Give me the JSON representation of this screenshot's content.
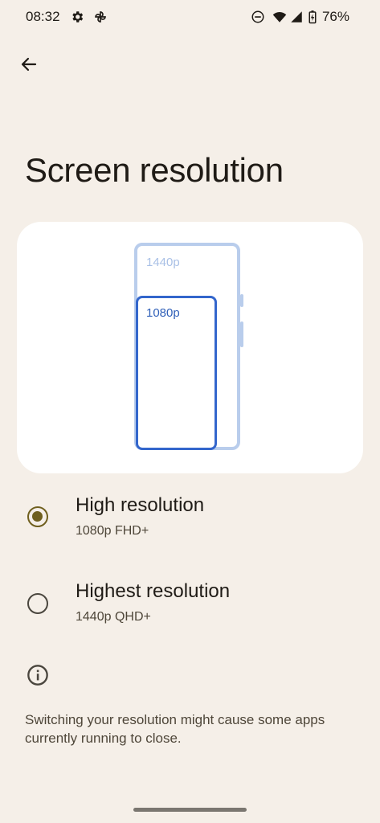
{
  "status_bar": {
    "time": "08:32",
    "battery_percent": "76%",
    "icons": [
      "settings-gear-icon",
      "pinwheel-icon",
      "do-not-disturb-icon",
      "wifi-icon",
      "signal-icon",
      "battery-charging-icon"
    ]
  },
  "header": {
    "back_icon": "arrow-back-icon",
    "title": "Screen resolution"
  },
  "illustration": {
    "outer_label": "1440p",
    "inner_label": "1080p"
  },
  "options": [
    {
      "title": "High resolution",
      "subtitle": "1080p FHD+",
      "selected": true
    },
    {
      "title": "Highest resolution",
      "subtitle": "1440p QHD+",
      "selected": false
    }
  ],
  "footer": {
    "icon": "info-icon",
    "text": "Switching your resolution might cause some apps currently running to close."
  },
  "colors": {
    "background": "#f5efe8",
    "accent": "#6f5f1e",
    "illustration_blue": "#3366cc",
    "illustration_light_blue": "#b9cdec"
  }
}
